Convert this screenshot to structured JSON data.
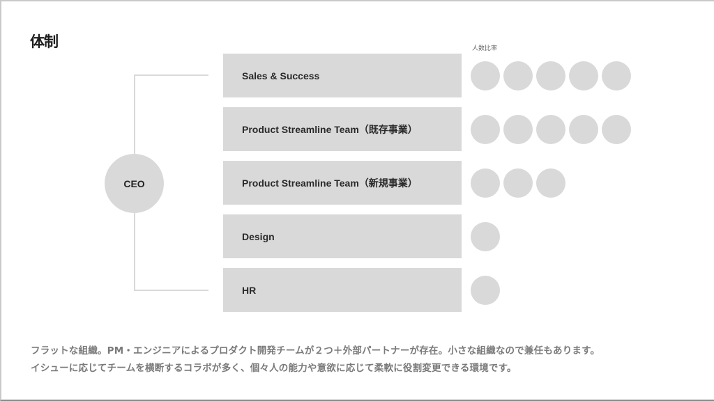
{
  "title": "体制",
  "ratio_label": "人数比率",
  "ceo": {
    "label": "CEO"
  },
  "teams": [
    {
      "label": "Sales & Success",
      "headcount_ratio": 5
    },
    {
      "label": "Product Streamline Team（既存事業）",
      "headcount_ratio": 5
    },
    {
      "label": "Product Streamline Team（新規事業）",
      "headcount_ratio": 3
    },
    {
      "label": "Design",
      "headcount_ratio": 1
    },
    {
      "label": "HR",
      "headcount_ratio": 1
    }
  ],
  "description": [
    "フラットな組織。PM・エンジニアによるプロダクト開発チームが２つ＋外部パートナーが存在。小さな組織なので兼任もあります。",
    "イシューに応じてチームを横断するコラボが多く、個々人の能力や意欲に応じて柔軟に役割変更できる環境です。"
  ],
  "colors": {
    "shape_fill": "#d9d9d9",
    "text_dark": "#222222",
    "text_muted": "#7a7a7a"
  }
}
